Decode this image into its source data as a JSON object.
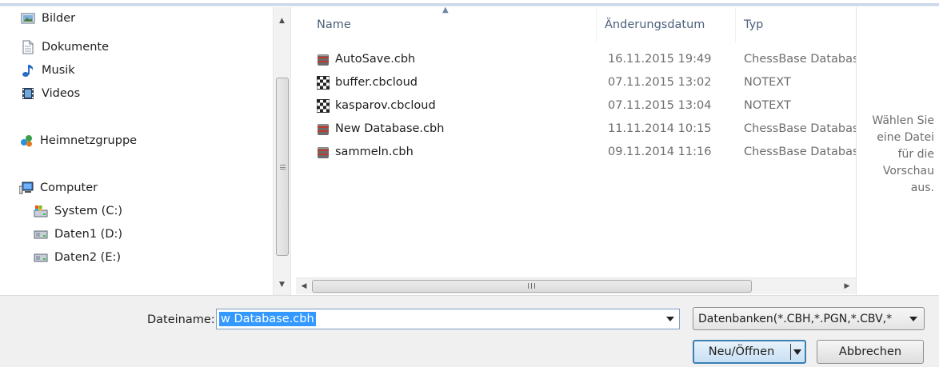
{
  "nav": {
    "items": [
      {
        "label": "Bilder",
        "icon": "pictures-icon",
        "indent": 1
      },
      {
        "label": "Dokumente",
        "icon": "documents-icon",
        "indent": 1
      },
      {
        "label": "Musik",
        "icon": "music-icon",
        "indent": 1
      },
      {
        "label": "Videos",
        "icon": "videos-icon",
        "indent": 1
      },
      {
        "label": "Heimnetzgruppe",
        "icon": "homegroup-icon",
        "indent": 0
      },
      {
        "label": "Computer",
        "icon": "computer-icon",
        "indent": 0
      },
      {
        "label": "System (C:)",
        "icon": "system-drive-icon",
        "indent": 1
      },
      {
        "label": "Daten1 (D:)",
        "icon": "drive-icon",
        "indent": 1
      },
      {
        "label": "Daten2 (E:)",
        "icon": "drive-icon",
        "indent": 1
      }
    ]
  },
  "list": {
    "columns": {
      "name": "Name",
      "date": "Änderungsdatum",
      "type": "Typ"
    },
    "files": [
      {
        "name": "AutoSave.cbh",
        "date": "16.11.2015 19:49",
        "type": "ChessBase Database",
        "icon": "database-icon"
      },
      {
        "name": "buffer.cbcloud",
        "date": "07.11.2015 13:02",
        "type": "NOTEXT",
        "icon": "chessboard-icon"
      },
      {
        "name": "kasparov.cbcloud",
        "date": "07.11.2015 13:04",
        "type": "NOTEXT",
        "icon": "chessboard-icon"
      },
      {
        "name": "New Database.cbh",
        "date": "11.11.2014 10:15",
        "type": "ChessBase Database",
        "icon": "database-icon"
      },
      {
        "name": "sammeln.cbh",
        "date": "09.11.2014 11:16",
        "type": "ChessBase Database",
        "icon": "database-icon"
      }
    ],
    "hscroll_grip": "III"
  },
  "preview": {
    "text_lines": [
      "Wählen Sie",
      "eine Datei",
      "für die",
      "Vorschau",
      "aus."
    ]
  },
  "bottom": {
    "filename_label": "Dateiname:",
    "filename_value": "w Database.cbh",
    "filetype_value": "Datenbanken(*.CBH,*.PGN,*.CBV,*",
    "open_label": "Neu/Öffnen",
    "cancel_label": "Abbrechen"
  },
  "colors": {
    "selection": "#3399ff",
    "header_text": "#4c607a",
    "secondary_text": "#6d6d6d",
    "panel_bg": "#f0f0f0"
  }
}
